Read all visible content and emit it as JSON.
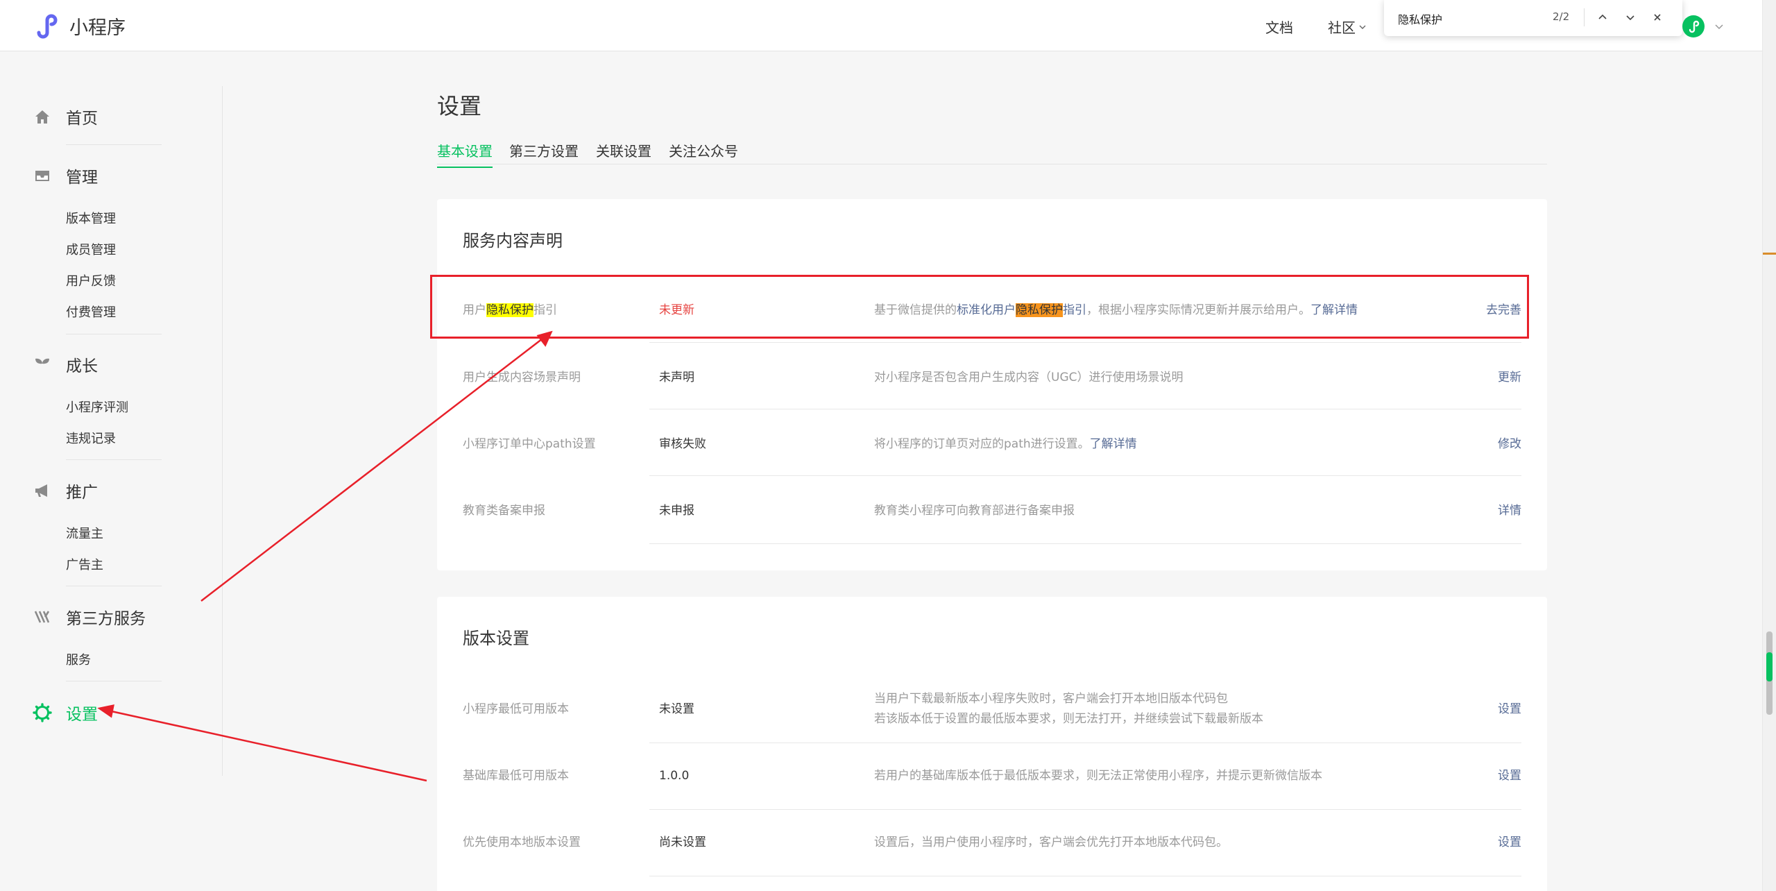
{
  "header": {
    "logo_text": "小程序",
    "nav": {
      "docs": "文档",
      "community": "社区"
    },
    "find_bar": {
      "query": "隐私保护",
      "count": "2/2"
    }
  },
  "sidebar": {
    "home": "首页",
    "manage": {
      "title": "管理",
      "items": [
        "版本管理",
        "成员管理",
        "用户反馈",
        "付费管理"
      ]
    },
    "growth": {
      "title": "成长",
      "items": [
        "小程序评测",
        "违规记录"
      ]
    },
    "promote": {
      "title": "推广",
      "items": [
        "流量主",
        "广告主"
      ]
    },
    "third_party": {
      "title": "第三方服务",
      "items": [
        "服务"
      ]
    },
    "settings": "设置"
  },
  "main": {
    "title": "设置",
    "tabs": [
      "基本设置",
      "第三方设置",
      "关联设置",
      "关注公众号"
    ],
    "service_section": {
      "title": "服务内容声明",
      "privacy_row": {
        "name_pre": "用户",
        "name_hl": "隐私保护",
        "name_post": "指引",
        "status": "未更新",
        "desc_pre": "基于微信提供的",
        "desc_link_pre": "标准化用户",
        "desc_link_hl": "隐私保护",
        "desc_link_post": "指引",
        "desc_post": "，根据小程序实际情况更新并展示给用户。",
        "desc_more": "了解详情",
        "action": "去完善"
      },
      "rows": [
        {
          "name": "用户生成内容场景声明",
          "status": "未声明",
          "desc": "对小程序是否包含用户生成内容（UGC）进行使用场景说明",
          "more": "",
          "action": "更新"
        },
        {
          "name": "小程序订单中心path设置",
          "status": "审核失败",
          "desc": "将小程序的订单页对应的path进行设置。",
          "more": "了解详情",
          "action": "修改"
        },
        {
          "name": "教育类备案申报",
          "status": "未申报",
          "desc": "教育类小程序可向教育部进行备案申报",
          "more": "",
          "action": "详情"
        }
      ]
    },
    "version_section": {
      "title": "版本设置",
      "rows": [
        {
          "name": "小程序最低可用版本",
          "status": "未设置",
          "desc": "当用户下载最新版本小程序失败时，客户端会打开本地旧版本代码包",
          "desc2": "若该版本低于设置的最低版本要求，则无法打开，并继续尝试下载最新版本",
          "action": "设置"
        },
        {
          "name": "基础库最低可用版本",
          "status": "1.0.0",
          "desc": "若用户的基础库版本低于最低版本要求，则无法正常使用小程序，并提示更新微信版本",
          "desc2": "",
          "action": "设置"
        },
        {
          "name": "优先使用本地版本设置",
          "status": "尚未设置",
          "desc": "设置后，当用户使用小程序时，客户端会优先打开本地版本代码包。",
          "desc2": "",
          "action": "设置"
        }
      ]
    }
  },
  "colors": {
    "brand": "#07c160",
    "link": "#576b95",
    "warn": "#e64340",
    "annotation": "#e8202a",
    "highlight": "#ffff00",
    "highlight_current": "#f7941d"
  }
}
